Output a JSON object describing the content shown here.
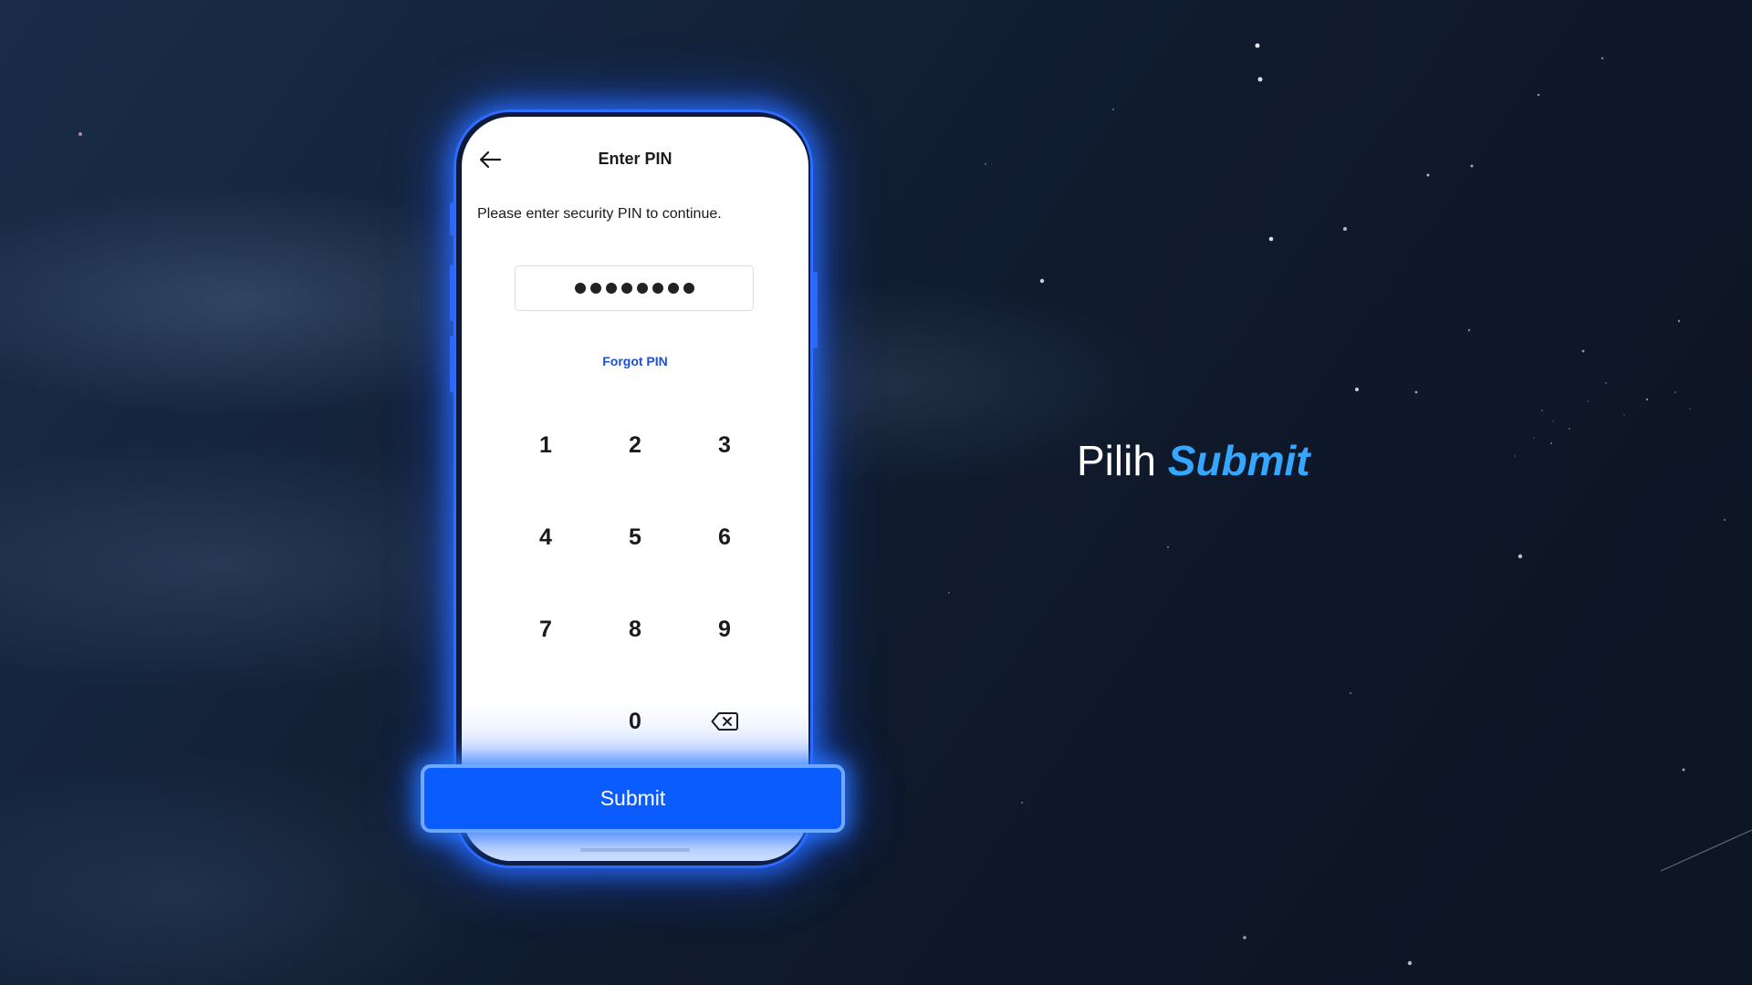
{
  "screen": {
    "title": "Enter PIN",
    "instruction": "Please enter security PIN to continue.",
    "pin_value": "••••••••",
    "pin_length": 8,
    "forgot_label": "Forgot PIN"
  },
  "keypad": {
    "keys": [
      "1",
      "2",
      "3",
      "4",
      "5",
      "6",
      "7",
      "8",
      "9",
      "0"
    ],
    "backspace_icon": "backspace-icon"
  },
  "submit_label": "Submit",
  "caption": {
    "prefix": "Pilih",
    "highlight": "Submit"
  },
  "colors": {
    "accent": "#0b5cff",
    "caption_accent": "#35a7ff",
    "link": "#1d4fd8",
    "background": "#101b2e"
  },
  "icons": {
    "back": "arrow-left-icon",
    "backspace": "backspace-icon"
  }
}
